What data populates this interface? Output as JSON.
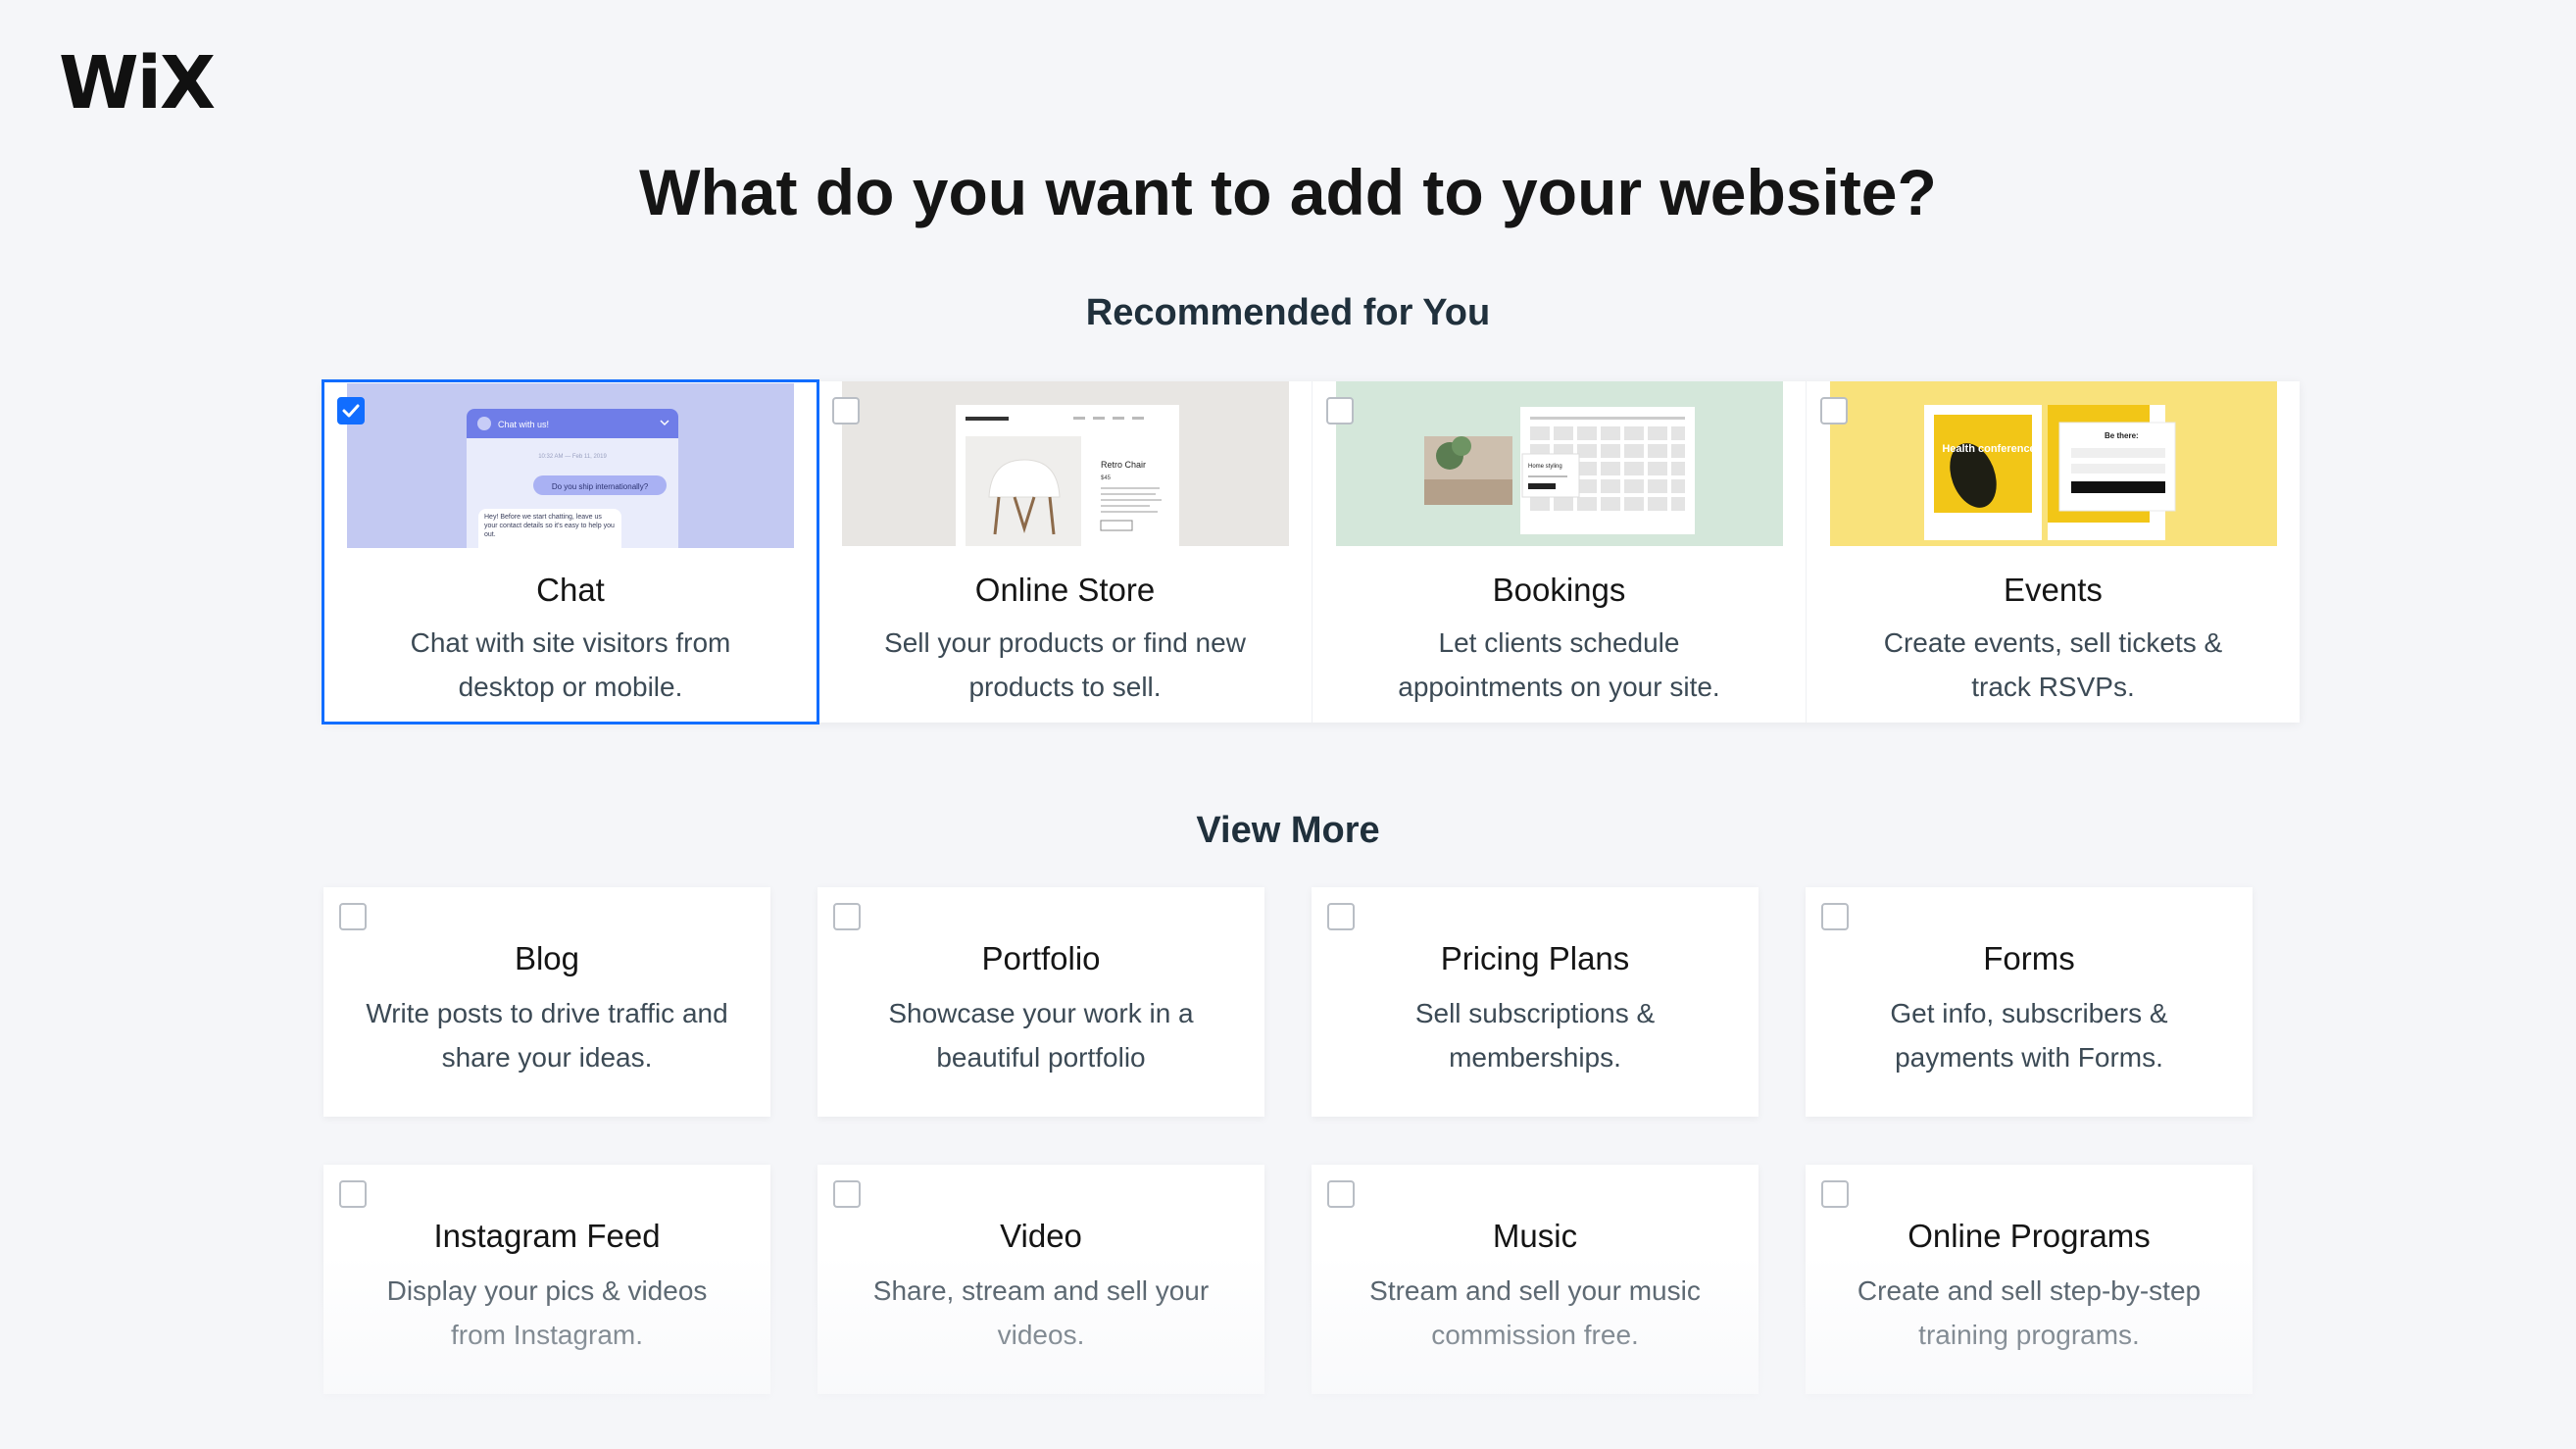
{
  "brand": {
    "logo_text": "WiX"
  },
  "page_title": "What do you want to add to your website?",
  "recommended": {
    "title": "Recommended for You",
    "items": [
      {
        "name": "Chat",
        "desc": "Chat with site visitors from desktop or mobile.",
        "checked": true,
        "thumb_bg": "#c3c9f2",
        "chat_header": "Chat with us!",
        "chat_date": "10:32 AM — Feb 11, 2019",
        "chat_question": "Do you ship internationally?",
        "chat_reply": "Hey! Before we start chatting, leave us your contact details so it's easy to help you out."
      },
      {
        "name": "Online Store",
        "desc": "Sell your products or find new products to sell.",
        "checked": false,
        "thumb_bg": "#e8e6e3",
        "product_title": "Retro Chair",
        "product_price": "$45"
      },
      {
        "name": "Bookings",
        "desc": "Let clients schedule appointments on your site.",
        "checked": false,
        "thumb_bg": "#d4e7da",
        "booking_title": "Home styling"
      },
      {
        "name": "Events",
        "desc": "Create events, sell tickets & track RSVPs.",
        "checked": false,
        "thumb_bg": "#f9e27b",
        "event_title": "Health conference",
        "form_title": "Be there:"
      }
    ]
  },
  "more": {
    "title": "View More",
    "items": [
      {
        "name": "Blog",
        "desc": "Write posts to drive traffic and share your ideas.",
        "checked": false
      },
      {
        "name": "Portfolio",
        "desc": "Showcase your work in a beautiful portfolio",
        "checked": false
      },
      {
        "name": "Pricing Plans",
        "desc": "Sell subscriptions & memberships.",
        "checked": false
      },
      {
        "name": "Forms",
        "desc": "Get info, subscribers & payments with Forms.",
        "checked": false
      },
      {
        "name": "Instagram Feed",
        "desc": "Display your pics & videos from Instagram.",
        "checked": false
      },
      {
        "name": "Video",
        "desc": "Share, stream and sell your videos.",
        "checked": false
      },
      {
        "name": "Music",
        "desc": "Stream and sell your music commission free.",
        "checked": false
      },
      {
        "name": "Online Programs",
        "desc": "Create and sell step-by-step training programs.",
        "checked": false
      }
    ]
  },
  "colors": {
    "accent": "#116dff",
    "background": "#f5f6f9"
  }
}
